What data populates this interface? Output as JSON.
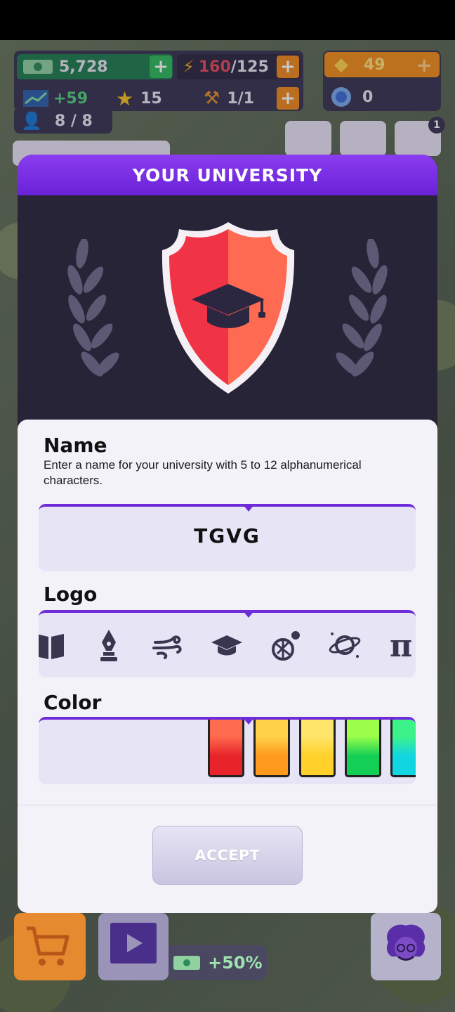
{
  "hud": {
    "cash": "5,728",
    "energy_current": "160",
    "energy_max": "/125",
    "gems": "49",
    "income": "+59",
    "stars": "15",
    "builders": "1/1",
    "students": "8 / 8",
    "tokens": "0",
    "lab_badge": "1"
  },
  "modal": {
    "title": "YOUR UNIVERSITY",
    "name_section": {
      "title": "Name",
      "description": "Enter a name for your university with 5 to 12 alphanumerical characters.",
      "value": "TGVG"
    },
    "logo_section": {
      "title": "Logo",
      "icons": [
        "book-icon",
        "pen-nib-icon",
        "wind-icon",
        "graduation-cap-icon",
        "sports-ball-icon",
        "planet-icon",
        "pi-icon"
      ],
      "selected": "graduation-cap-icon"
    },
    "color_section": {
      "title": "Color",
      "swatches": [
        {
          "top": "#ff6b4f",
          "bottom": "#e8242a"
        },
        {
          "top": "#ffd24a",
          "bottom": "#ff9a1c"
        },
        {
          "top": "#ffe66a",
          "bottom": "#ffd12a"
        },
        {
          "top": "#9bff4a",
          "bottom": "#14cf55"
        },
        {
          "top": "#3ef28a",
          "bottom": "#11d5e0"
        }
      ]
    },
    "accept_label": "ACCEPT"
  },
  "bottom_bar": {
    "bonus": "+50%"
  },
  "colors": {
    "accent_purple": "#6e2bd9",
    "shield_left": "#ff3a4a",
    "shield_right": "#ff6f52"
  }
}
